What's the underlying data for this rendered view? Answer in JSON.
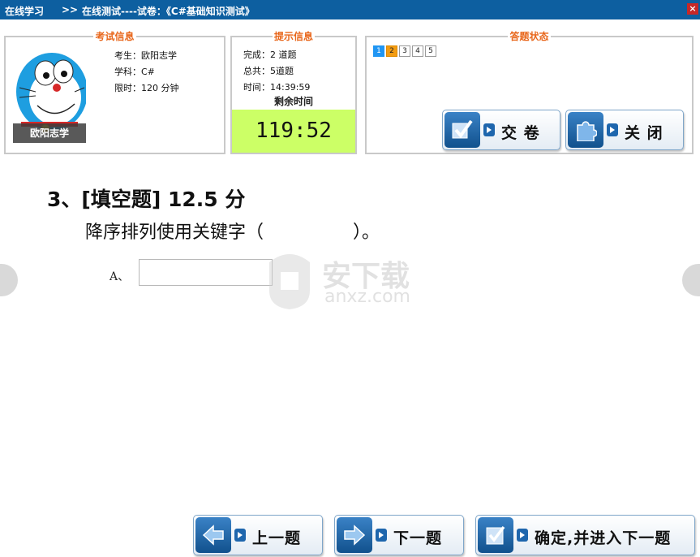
{
  "titlebar": {
    "home": "在线学习",
    "sep": ">>",
    "path": "在线测试----试卷：《C#基础知识测试》",
    "close": "×"
  },
  "exam_info": {
    "legend": "考试信息",
    "name_label": "考生：欧阳志学",
    "subject_label": "学科：C#",
    "limit_label": "限时：120 分钟",
    "avatar_name": "欧阳志学"
  },
  "tip_info": {
    "legend": "提示信息",
    "done": "完成：2 道题",
    "total": "总共：5道题",
    "time": "时间：14:39:59",
    "remain_label": "剩余时间",
    "countdown": "119:52"
  },
  "status": {
    "legend": "答题状态",
    "questions": [
      {
        "num": "1",
        "state": "answered"
      },
      {
        "num": "2",
        "state": "current"
      },
      {
        "num": "3",
        "state": "normal"
      },
      {
        "num": "4",
        "state": "normal"
      },
      {
        "num": "5",
        "state": "normal"
      }
    ],
    "submit_label": "交 卷",
    "close_label": "关 闭"
  },
  "question": {
    "title": "3、[填空题] 12.5 分",
    "text": "降序排列使用关键字（　　　　　）。",
    "option_label": "A、",
    "answer_value": ""
  },
  "nav": {
    "prev_label": "上一题",
    "next_label": "下一题",
    "confirm_label": "确定,并进入下一题"
  },
  "watermark": {
    "text": "安下载",
    "sub": "anxz.com"
  },
  "colors": {
    "titlebar": "#0d5fa0",
    "legend": "#e8661a",
    "countdown_bg": "#ccff66",
    "answered": "#2196f3",
    "current": "#f39c12"
  }
}
